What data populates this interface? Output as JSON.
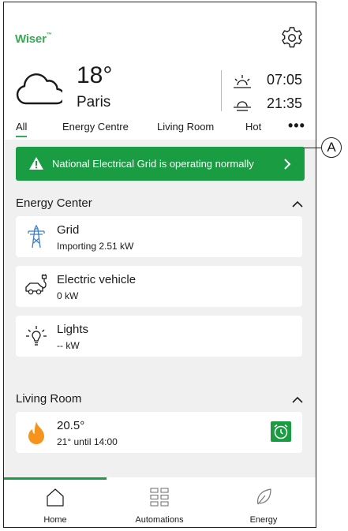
{
  "app": {
    "logo_text": "Wiser",
    "logo_tm": "™",
    "brand_color": "#3aa856"
  },
  "weather": {
    "temperature": "18°",
    "city": "Paris",
    "sunrise": "07:05",
    "sunset": "21:35",
    "icon": "cloud-icon"
  },
  "tabs": [
    {
      "label": "All",
      "active": true
    },
    {
      "label": "Energy Centre"
    },
    {
      "label": "Living Room"
    },
    {
      "label": "Hot"
    }
  ],
  "more_label": "•••",
  "banner": {
    "text": "National Electrical Grid is operating normally",
    "color": "#1a9c43"
  },
  "energy_center": {
    "title": "Energy Center",
    "cards": [
      {
        "name": "Grid",
        "value": "Importing 2.51 kW",
        "icon": "grid-pylon-icon"
      },
      {
        "name": "Electric vehicle",
        "value": "0 kW",
        "icon": "ev-car-icon"
      },
      {
        "name": "Lights",
        "value": "-- kW",
        "icon": "light-bulb-icon"
      }
    ]
  },
  "living_room": {
    "title": "Living Room",
    "card": {
      "temperature": "20.5°",
      "schedule": "21° until 14:00",
      "icon": "flame-icon"
    }
  },
  "nav": [
    {
      "label": "Home",
      "active": true
    },
    {
      "label": "Automations"
    },
    {
      "label": "Energy"
    }
  ],
  "callout": {
    "label": "A"
  }
}
